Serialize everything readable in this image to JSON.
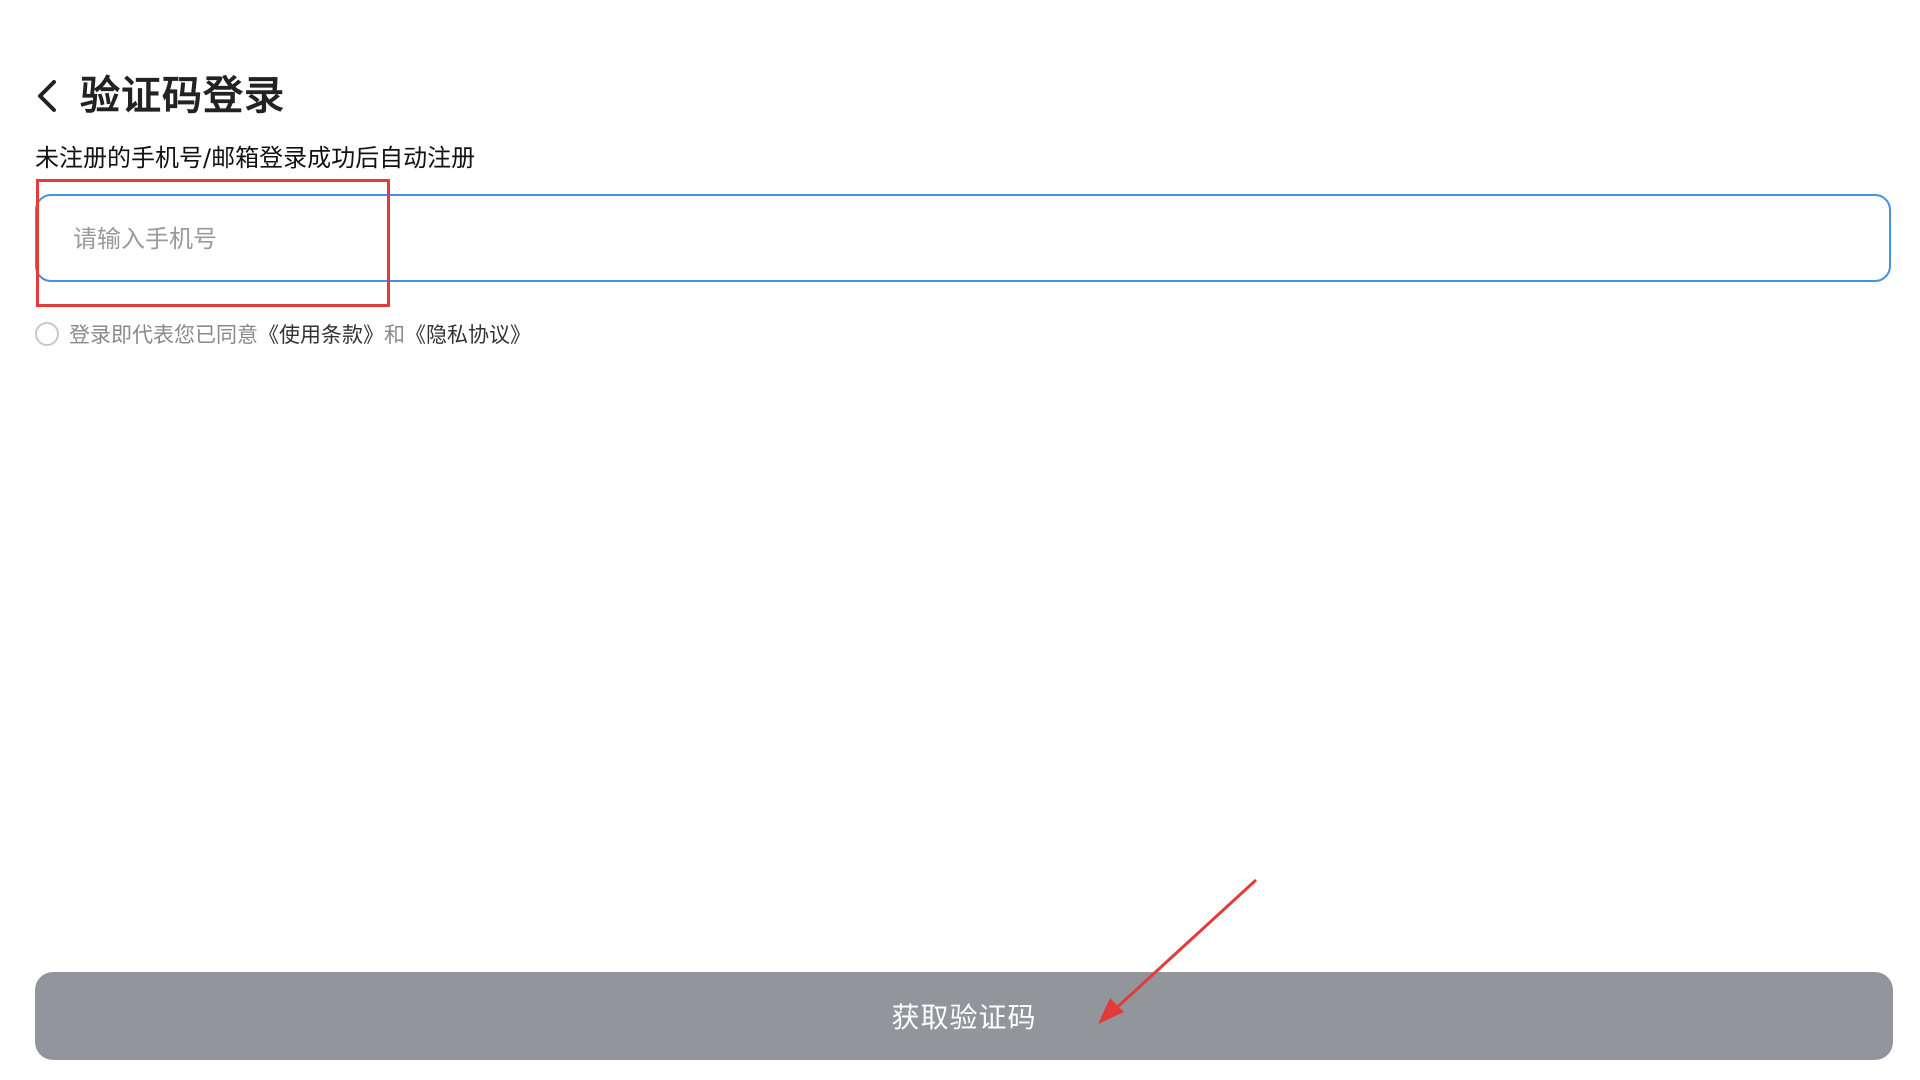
{
  "header": {
    "back_icon": "chevron-left-icon",
    "title": "验证码登录"
  },
  "subtitle": "未注册的手机号/邮箱登录成功后自动注册",
  "phone": {
    "placeholder": "请输入手机号",
    "value": ""
  },
  "agreement": {
    "checked": false,
    "prefix": "登录即代表您已同意",
    "terms_link": "《使用条款》",
    "conjunction": "和",
    "privacy_link": "《隐私协议》"
  },
  "submit": {
    "label": "获取验证码"
  },
  "colors": {
    "input_border": "#4a90e2",
    "button_bg": "#92959c",
    "annotation": "#e23b3b"
  }
}
